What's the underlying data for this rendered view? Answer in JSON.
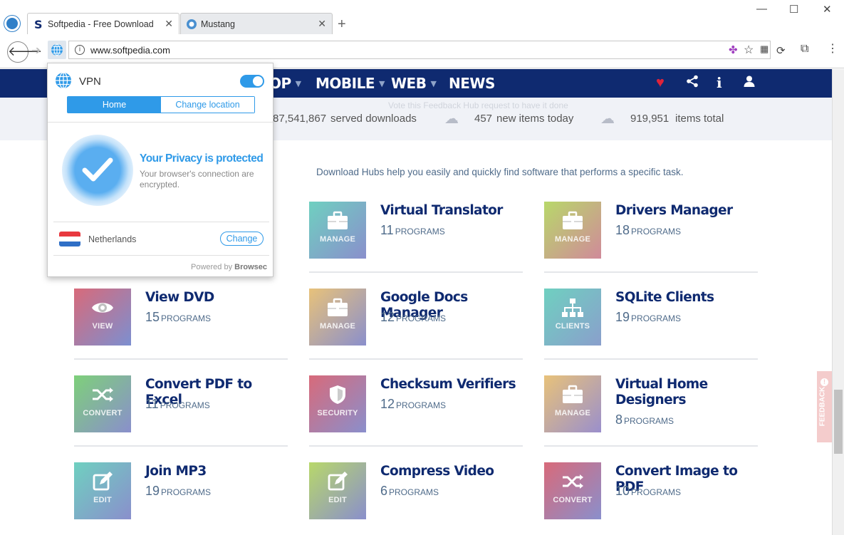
{
  "browser": {
    "tabs": [
      {
        "title": "Softpedia - Free Downloads Enc",
        "active": true
      },
      {
        "title": "Mustang",
        "active": false
      }
    ],
    "url": "www.softpedia.com",
    "window_controls": {
      "minimize": "—",
      "maximize": "☐",
      "close": "✕"
    }
  },
  "site": {
    "nav": [
      {
        "label": "OP"
      },
      {
        "label": "MOBILE"
      },
      {
        "label": "WEB"
      },
      {
        "label": "NEWS"
      }
    ],
    "faint_note": "Vote this Feedback Hub request to have it done",
    "stats": {
      "served_value": "87,541,867",
      "served_label": "served downloads",
      "new_value": "457",
      "new_label": "new items today",
      "total_value": "919,951",
      "total_label": "items total"
    },
    "hub_description": "Download Hubs help you easily and quickly find software that performs a specific task.",
    "programs_word": "PROGRAMS",
    "hubs": [
      {
        "title": "Virtual Translator",
        "count": "11",
        "tag": "MANAGE",
        "icon": "briefcase-icon"
      },
      {
        "title": "Drivers Manager",
        "count": "18",
        "tag": "MANAGE",
        "icon": "briefcase-icon"
      },
      {
        "title": "View DVD",
        "count": "15",
        "tag": "VIEW",
        "icon": "eye-icon"
      },
      {
        "title": "Google Docs Manager",
        "count": "12",
        "tag": "MANAGE",
        "icon": "briefcase-icon"
      },
      {
        "title": "SQLite Clients",
        "count": "19",
        "tag": "CLIENTS",
        "icon": "network-icon"
      },
      {
        "title": "Convert PDF to Excel",
        "count": "11",
        "tag": "CONVERT",
        "icon": "shuffle-icon"
      },
      {
        "title": "Checksum Verifiers",
        "count": "12",
        "tag": "SECURITY",
        "icon": "shield-icon"
      },
      {
        "title": "Virtual Home Designers",
        "count": "8",
        "tag": "MANAGE",
        "icon": "briefcase-icon"
      },
      {
        "title": "Join MP3",
        "count": "19",
        "tag": "EDIT",
        "icon": "edit-icon"
      },
      {
        "title": "Compress Video",
        "count": "6",
        "tag": "EDIT",
        "icon": "edit-icon"
      },
      {
        "title": "Convert Image to PDF",
        "count": "10",
        "tag": "CONVERT",
        "icon": "shuffle-icon"
      }
    ],
    "feedback_label": "FEEDBACK"
  },
  "vpn_popup": {
    "title": "VPN",
    "tabs": [
      "Home",
      "Change location"
    ],
    "status_title": "Your Privacy is protected",
    "status_text": "Your browser's connection are encrypted.",
    "country": "Netherlands",
    "change_label": "Change",
    "powered_by": "Powered by",
    "brand": "Browsec"
  },
  "colors": {
    "navbar": "#0f2a70",
    "accent": "#2f9ae8",
    "heart": "#e0233a"
  }
}
